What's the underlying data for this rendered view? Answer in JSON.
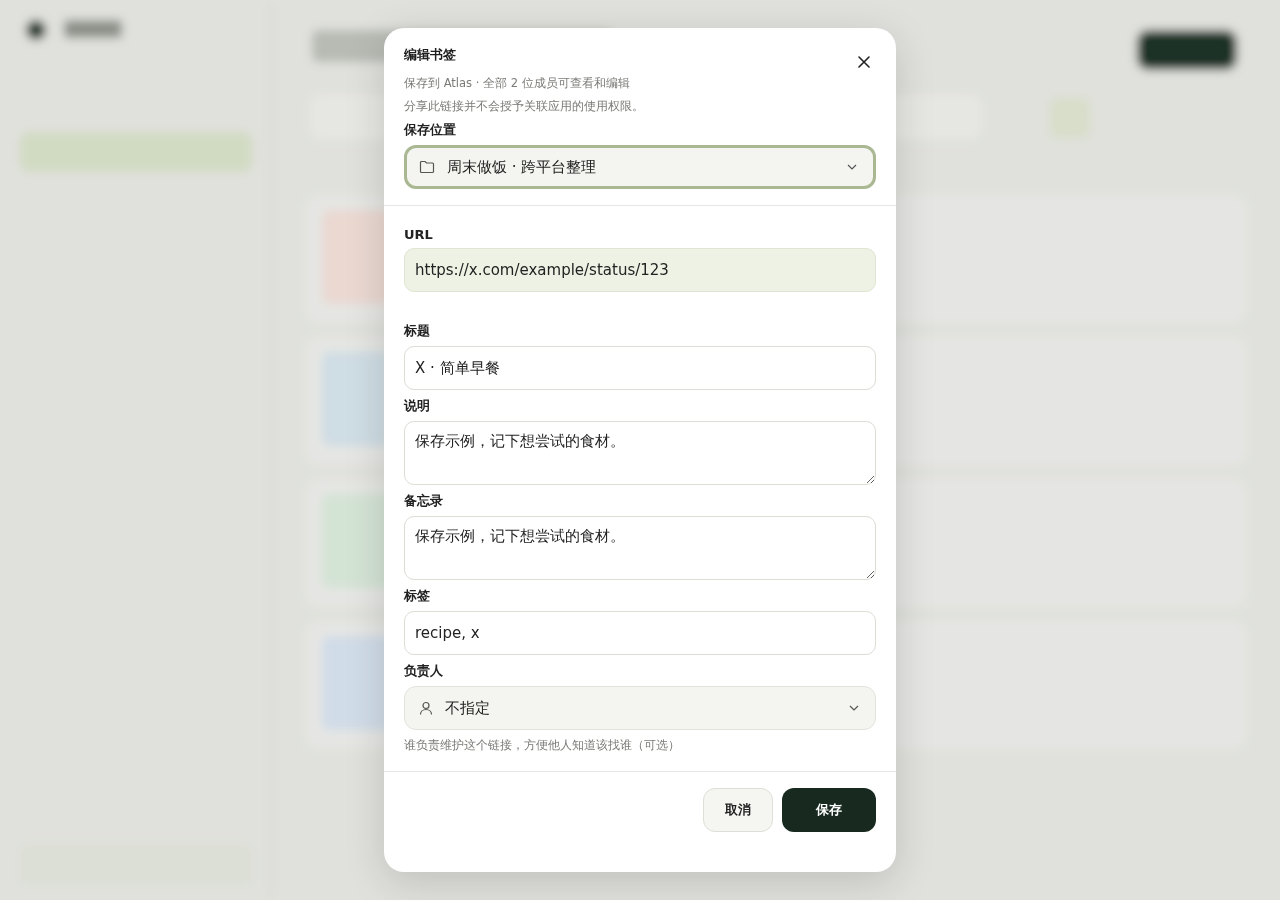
{
  "dialog": {
    "title": "编辑书签",
    "subtitle": "保存到 Atlas · 全部 2 位成员可查看和编辑",
    "note": "分享此链接并不会授予关联应用的使用权限。",
    "location": {
      "label": "保存位置",
      "value": "周末做饭 · 跨平台整理",
      "focused": true
    },
    "fields": [
      {
        "kind": "input",
        "label": "URL",
        "value": "https://x.com/example/status/123",
        "readonly": true
      },
      {
        "kind": "input",
        "label": "标题",
        "value": "X · 简单早餐",
        "readonly": false
      },
      {
        "kind": "textarea",
        "label": "说明",
        "value": "保存示例，记下想尝试的食材。",
        "readonly": false
      },
      {
        "kind": "textarea",
        "label": "备忘录",
        "value": "保存示例，记下想尝试的食材。",
        "readonly": false
      },
      {
        "kind": "input",
        "label": "标签",
        "value": "recipe, x",
        "readonly": false
      }
    ],
    "owner": {
      "label": "负责人",
      "value": "不指定",
      "hint": "谁负责维护这个链接，方便他人知道该找谁（可选）"
    },
    "buttons": [
      {
        "kind": "secondary",
        "label": "取消"
      },
      {
        "kind": "primary",
        "label": "保存"
      }
    ]
  }
}
